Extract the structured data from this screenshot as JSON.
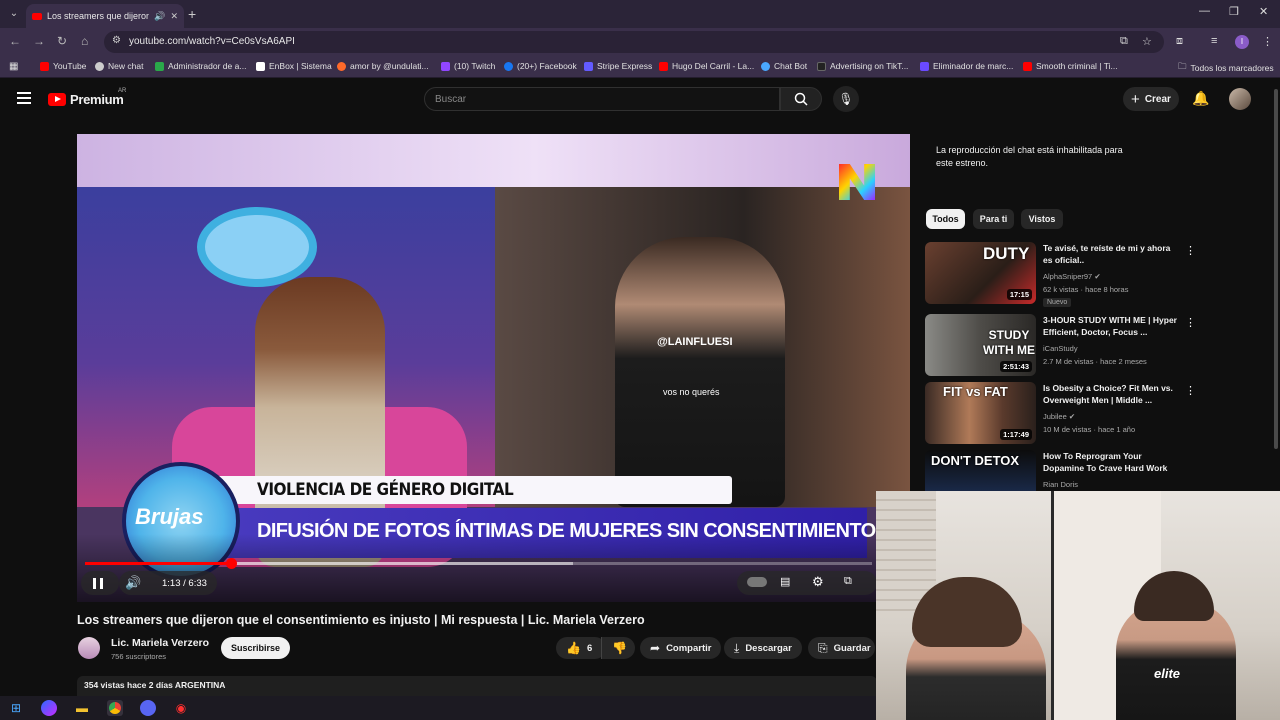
{
  "browser": {
    "tab_title": "Los streamers que dijeron q",
    "new_tab_label": "+",
    "url": "youtube.com/watch?v=Ce0sVsA6API",
    "bookmarks": [
      {
        "label": "YouTube",
        "color": "#ff0000"
      },
      {
        "label": "New chat",
        "color": "#cccccc"
      },
      {
        "label": "Administrador de a...",
        "color": "#2aa84a"
      },
      {
        "label": "EnBox | Sistema",
        "color": "#ffffff"
      },
      {
        "label": "amor by @undulati...",
        "color": "#ff6a2a"
      },
      {
        "label": "(10) Twitch",
        "color": "#9146ff"
      },
      {
        "label": "(20+) Facebook",
        "color": "#1877f2"
      },
      {
        "label": "Stripe Express",
        "color": "#635bff"
      },
      {
        "label": "Hugo Del Carril - La...",
        "color": "#ff0000"
      },
      {
        "label": "Chat Bot",
        "color": "#4aa8ff"
      },
      {
        "label": "Advertising on TikT...",
        "color": "#222222"
      },
      {
        "label": "Eliminador de marc...",
        "color": "#6a4aff"
      },
      {
        "label": "Smooth criminal | Ti...",
        "color": "#ff0000"
      }
    ],
    "all_bookmarks_label": "Todos los marcadores",
    "profile_initial": "I"
  },
  "header": {
    "logo_text": "Premium",
    "country_code": "AR",
    "search_placeholder": "Buscar",
    "create_label": "Crear"
  },
  "video": {
    "lower_third_line1": "VIOLENCIA DE GÉNERO DIGITAL",
    "lower_third_line2": "DIFUSIÓN DE FOTOS ÍNTIMAS DE MUJERES SIN CONSENTIMIENTO",
    "overlay_tag": "@LAINFLUESI",
    "overlay_subtitle": "vos no querés",
    "show_logo": "Brujas",
    "time_display": "1:13 / 6:33",
    "played_fraction": 0.186,
    "loaded_fraction": 0.62
  },
  "meta": {
    "title": "Los streamers que dijeron que el consentimiento es injusto | Mi respuesta | Lic. Mariela Verzero",
    "channel_name": "Lic. Mariela Verzero",
    "subscribers": "756 suscriptores",
    "subscribe_label": "Suscribirse",
    "likes": "6",
    "share_label": "Compartir",
    "download_label": "Descargar",
    "save_label": "Guardar",
    "description_line": "354 vistas  hace 2 días  ARGENTINA"
  },
  "sidebar": {
    "chat_disabled_text": "La reproducción del chat está inhabilitada para este estreno.",
    "chips": [
      "Todos",
      "Para ti",
      "Vistos"
    ],
    "recommendations": [
      {
        "title": "Te avisé, te reíste de mi y ahora es oficial..",
        "channel": "AlphaSniper97",
        "meta": "62 k vistas · hace 8 horas",
        "badge": "Nuevo",
        "duration": "17:15",
        "thumb_text": "DUTY"
      },
      {
        "title": "3-HOUR STUDY WITH ME | Hyper Efficient, Doctor, Focus ...",
        "channel": "iCanStudy",
        "meta": "2.7 M de vistas · hace 2 meses",
        "duration": "2:51:43",
        "thumb_text": "STUDY WITH ME"
      },
      {
        "title": "Is Obesity a Choice? Fit Men vs. Overweight Men | Middle ...",
        "channel": "Jubilee",
        "meta": "10 M de vistas · hace 1 año",
        "duration": "1:17:49",
        "thumb_text": "FIT vs FAT"
      },
      {
        "title": "How To Reprogram Your Dopamine To Crave Hard Work",
        "channel": "Rian Doris",
        "thumb_text": "DON'T DETOX"
      }
    ]
  },
  "webcam": {
    "shirt_logo": "elite"
  }
}
